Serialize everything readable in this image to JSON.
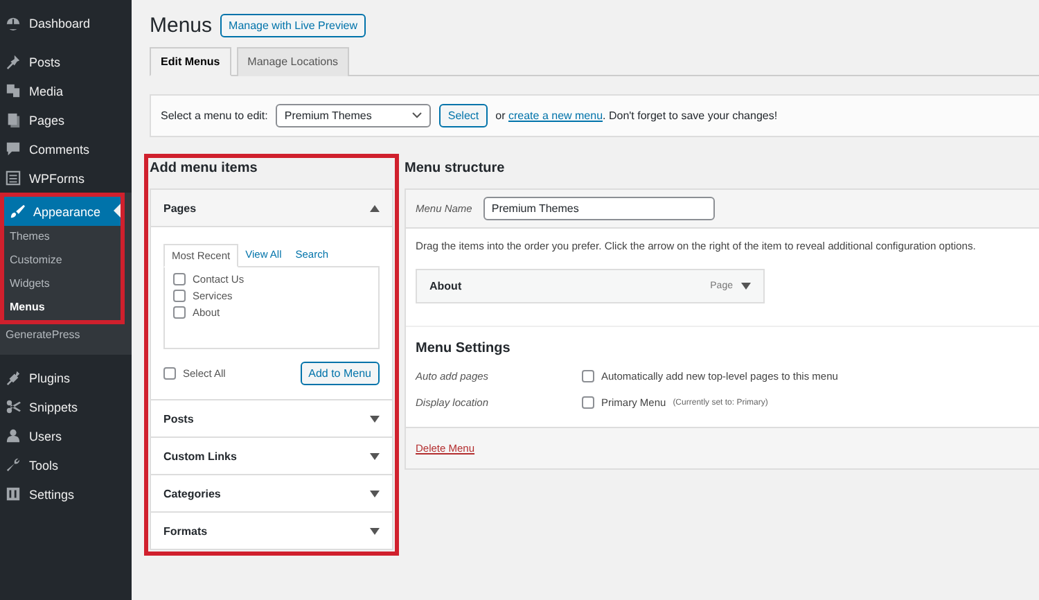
{
  "sidebar": {
    "items": [
      {
        "label": "Dashboard",
        "selected": false
      },
      {
        "label": "Posts",
        "selected": false
      },
      {
        "label": "Media",
        "selected": false
      },
      {
        "label": "Pages",
        "selected": false
      },
      {
        "label": "Comments",
        "selected": false
      },
      {
        "label": "WPForms",
        "selected": false
      },
      {
        "label": "Appearance",
        "selected": true,
        "highlighted": true,
        "children": [
          {
            "label": "Themes",
            "selected": false,
            "highlighted": true
          },
          {
            "label": "Customize",
            "selected": false,
            "highlighted": true
          },
          {
            "label": "Widgets",
            "selected": false,
            "highlighted": true
          },
          {
            "label": "Menus",
            "selected": true,
            "highlighted": true
          },
          {
            "label": "GeneratePress",
            "selected": false,
            "highlighted": false
          }
        ]
      },
      {
        "label": "Plugins",
        "selected": false
      },
      {
        "label": "Snippets",
        "selected": false
      },
      {
        "label": "Users",
        "selected": false
      },
      {
        "label": "Tools",
        "selected": false
      },
      {
        "label": "Settings",
        "selected": false
      }
    ]
  },
  "page": {
    "title": "Menus",
    "live_preview_button": "Manage with Live Preview"
  },
  "tabs": [
    {
      "label": "Edit Menus",
      "selected": true
    },
    {
      "label": "Manage Locations",
      "selected": false
    }
  ],
  "menu_select": {
    "label": "Select a menu to edit:",
    "value": "Premium Themes",
    "button": "Select",
    "or_text": "or",
    "create_link": "create a new menu",
    "note": ". Don't forget to save your changes!"
  },
  "add_menu_items": {
    "title": "Add menu items",
    "highlighted": true,
    "sections": [
      {
        "title": "Pages",
        "expanded": true,
        "tabs": [
          {
            "label": "Most Recent",
            "selected": true
          },
          {
            "label": "View All",
            "selected": false
          },
          {
            "label": "Search",
            "selected": false
          }
        ],
        "items": [
          {
            "label": "Contact Us",
            "checked": false
          },
          {
            "label": "Services",
            "checked": false
          },
          {
            "label": "About",
            "checked": false
          }
        ],
        "select_all": {
          "label": "Select All",
          "checked": false
        },
        "add_button": "Add to Menu"
      },
      {
        "title": "Posts",
        "expanded": false
      },
      {
        "title": "Custom Links",
        "expanded": false
      },
      {
        "title": "Categories",
        "expanded": false
      },
      {
        "title": "Formats",
        "expanded": false
      }
    ]
  },
  "menu_structure": {
    "title": "Menu structure",
    "name_label": "Menu Name",
    "name_value": "Premium Themes",
    "instructions": "Drag the items into the order you prefer. Click the arrow on the right of the item to reveal additional configuration options.",
    "items": [
      {
        "title": "About",
        "type": "Page"
      }
    ],
    "settings_title": "Menu Settings",
    "settings": [
      {
        "label": "Auto add pages",
        "option": "Automatically add new top-level pages to this menu",
        "checked": false
      },
      {
        "label": "Display location",
        "option": "Primary Menu",
        "note": "(Currently set to: Primary)",
        "checked": false
      }
    ],
    "delete_link": "Delete Menu"
  }
}
